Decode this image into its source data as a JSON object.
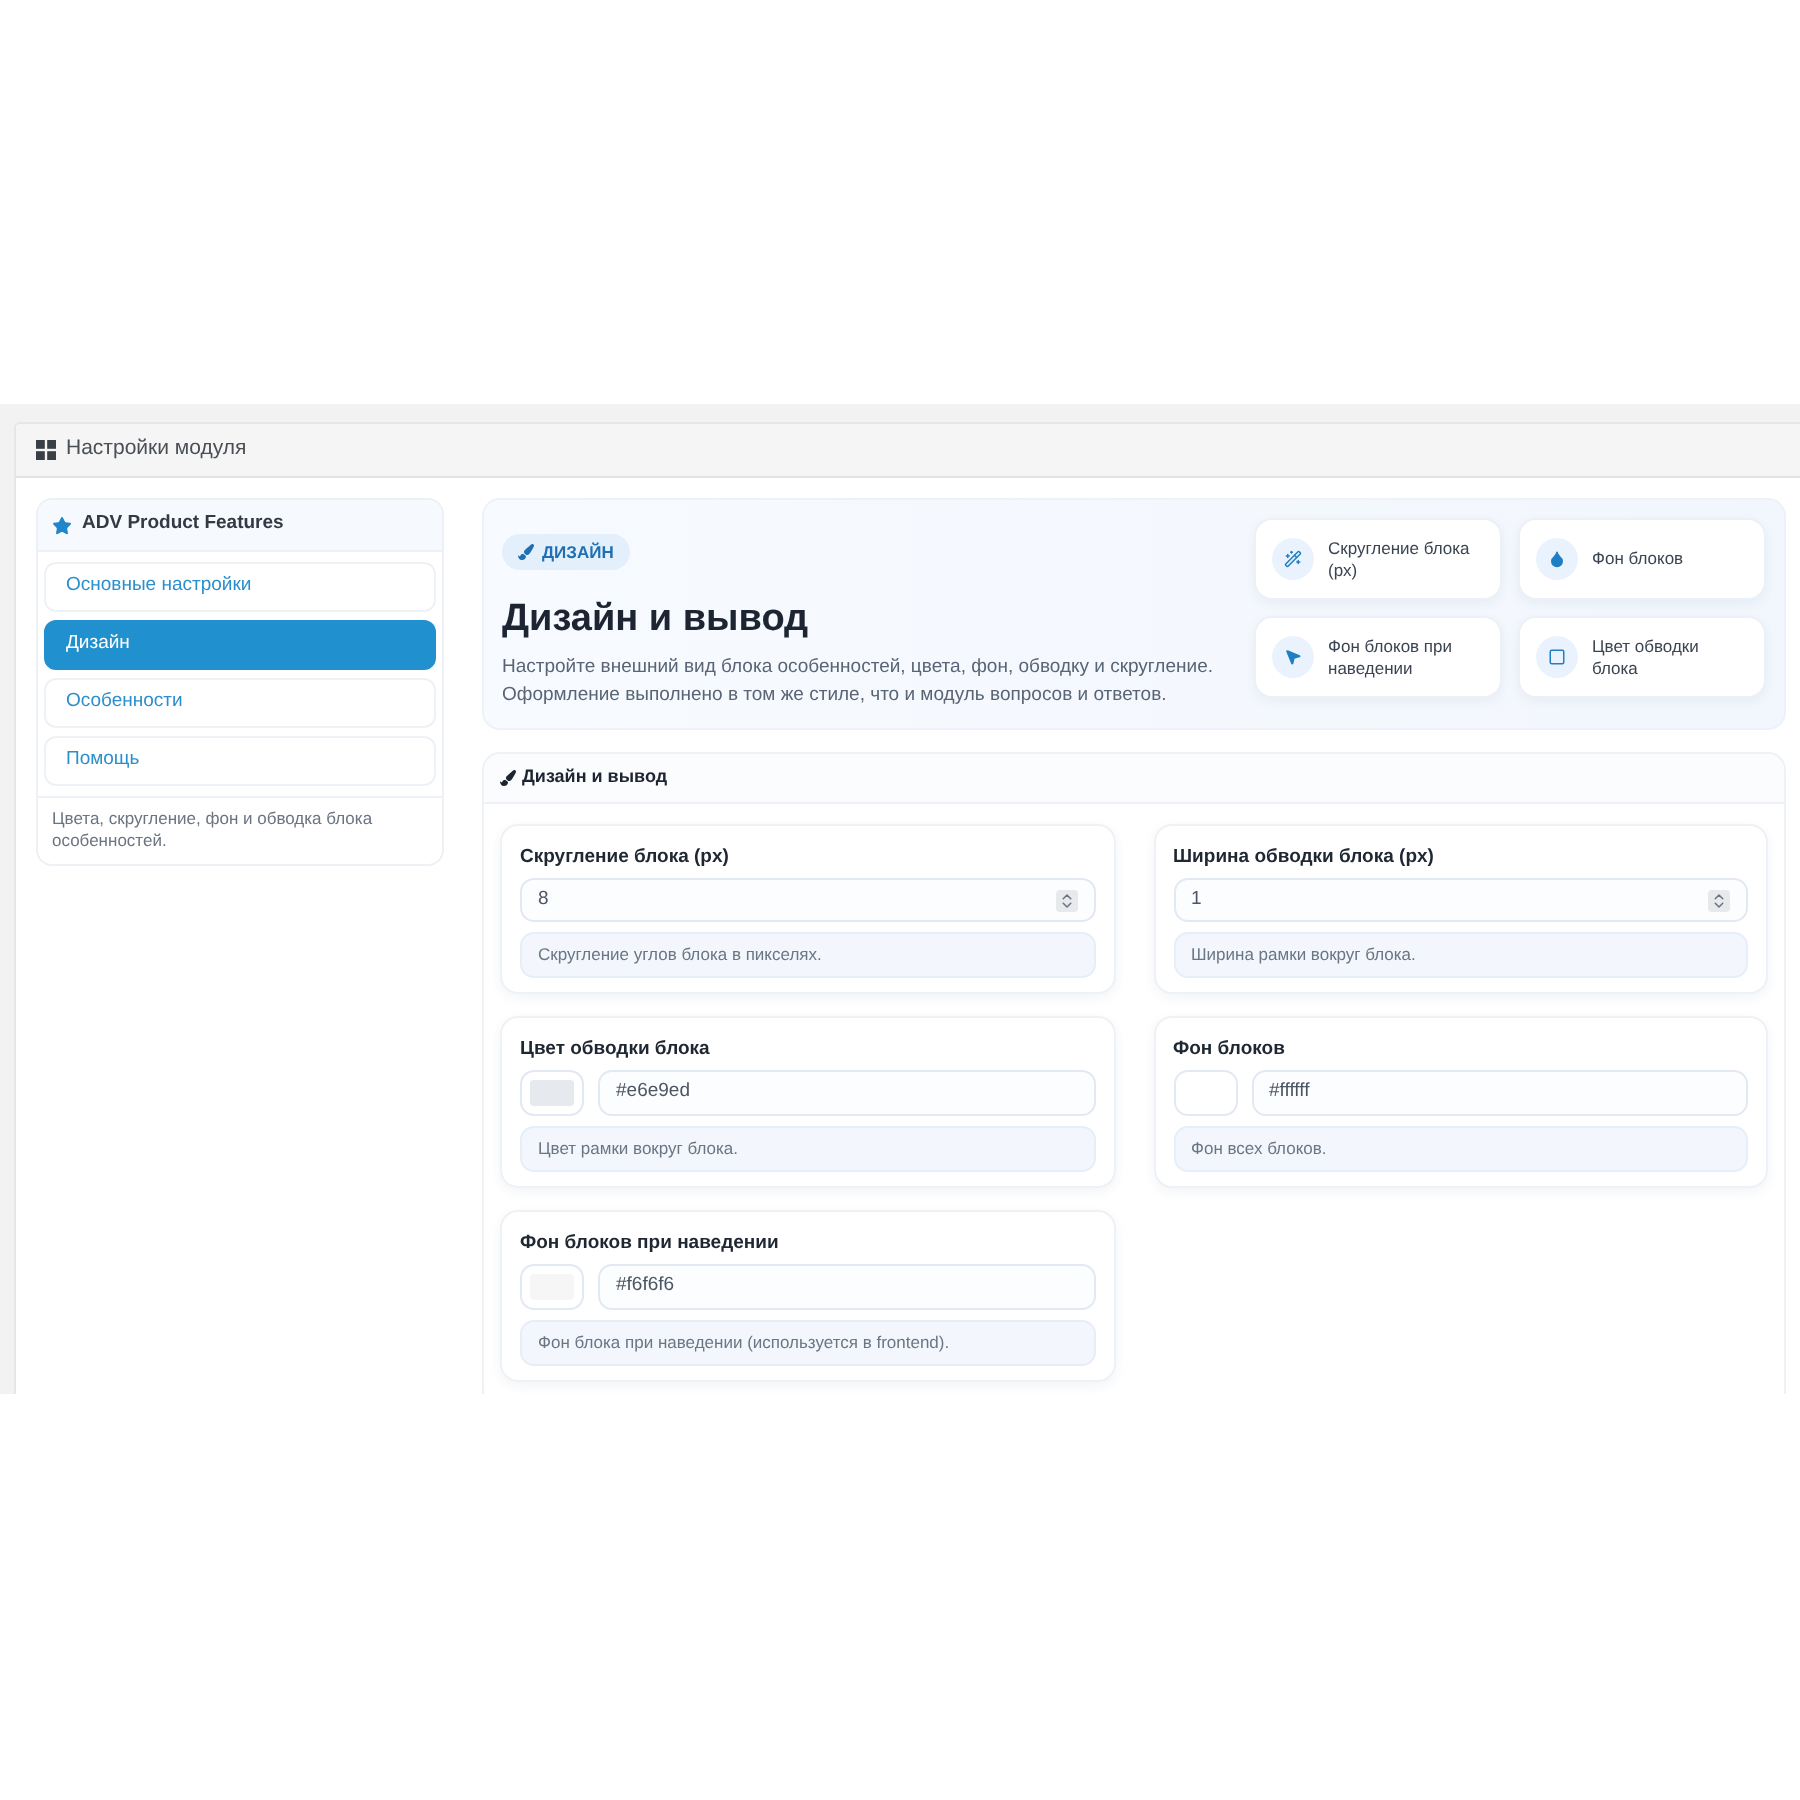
{
  "header": {
    "title": "Настройки модуля"
  },
  "sidebar": {
    "title": "ADV Product Features",
    "items": [
      {
        "label": "Основные настройки",
        "selected": false
      },
      {
        "label": "Дизайн",
        "selected": true
      },
      {
        "label": "Особенности",
        "selected": false
      },
      {
        "label": "Помощь",
        "selected": false
      }
    ],
    "note": "Цвета, скругление, фон и обводка блока особенностей."
  },
  "hero": {
    "badge": "ДИЗАЙН",
    "title": "Дизайн и вывод",
    "description": "Настройте внешний вид блока особенностей, цвета, фон, обводку и скругление. Оформление выполнено в том же стиле, что и модуль вопросов и ответов.",
    "features": [
      "Скругление блока (px)",
      "Фон блоков",
      "Фон блоков при наведении",
      "Цвет обводки блока"
    ]
  },
  "section": {
    "title": "Дизайн и вывод",
    "fields": [
      {
        "kind": "number",
        "label": "Скругление блока (px)",
        "value": "8",
        "help": "Скругление углов блока в пикселях."
      },
      {
        "kind": "number",
        "label": "Ширина обводки блока (px)",
        "value": "1",
        "help": "Ширина рамки вокруг блока."
      },
      {
        "kind": "color",
        "label": "Цвет обводки блока",
        "value": "#e6e9ed",
        "color": "#e6e9ed",
        "help": "Цвет рамки вокруг блока."
      },
      {
        "kind": "color",
        "label": "Фон блоков",
        "value": "#ffffff",
        "color": "#ffffff",
        "help": "Фон всех блоков."
      },
      {
        "kind": "color",
        "label": "Фон блоков при наведении",
        "value": "#f6f6f6",
        "color": "#f6f6f6",
        "help": "Фон блока при наведении (используется в frontend)."
      }
    ]
  }
}
